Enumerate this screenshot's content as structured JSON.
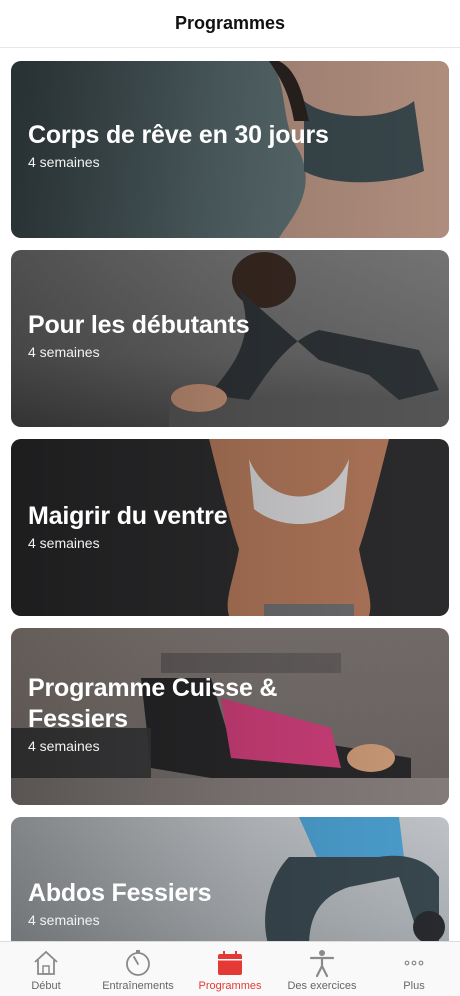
{
  "header": {
    "title": "Programmes"
  },
  "programs": [
    {
      "title": "Corps de rêve en 30 jours",
      "subtitle": "4 semaines"
    },
    {
      "title": "Pour les débutants",
      "subtitle": "4 semaines"
    },
    {
      "title": "Maigrir du ventre",
      "subtitle": "4 semaines"
    },
    {
      "title": "Programme Cuisse & Fessiers",
      "subtitle": "4 semaines"
    },
    {
      "title": "Abdos Fessiers",
      "subtitle": "4 semaines"
    }
  ],
  "tabs": [
    {
      "label": "Début",
      "icon": "home-icon",
      "active": false
    },
    {
      "label": "Entraînements",
      "icon": "timer-icon",
      "active": false
    },
    {
      "label": "Programmes",
      "icon": "calendar-icon",
      "active": true
    },
    {
      "label": "Des exercices",
      "icon": "person-icon",
      "active": false
    },
    {
      "label": "Plus",
      "icon": "more-icon",
      "active": false
    }
  ],
  "colors": {
    "accent": "#e53935",
    "inactive": "#8a8a8a"
  }
}
